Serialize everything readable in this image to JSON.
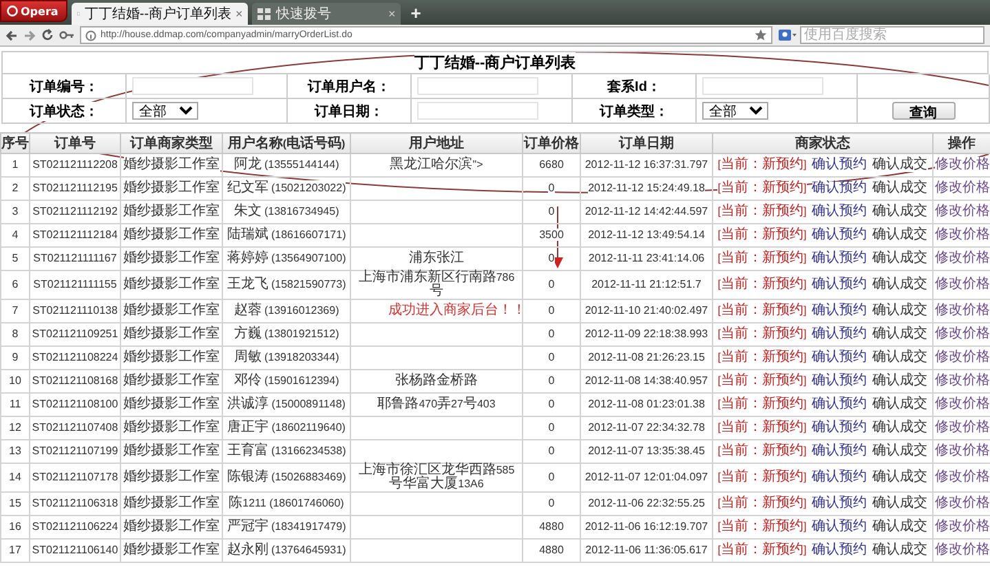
{
  "browser": {
    "menu_button": "Opera",
    "tabs": [
      {
        "title": "丁丁结婚--商户订单列表",
        "selected": true,
        "close": "×"
      },
      {
        "title": "快速拨号",
        "selected": false,
        "close": "×"
      }
    ],
    "new_tab": "+",
    "address": "http://house.ddmap.com/companyadmin/marryOrderList.do",
    "search": {
      "placeholder": "使用百度搜索"
    }
  },
  "page": {
    "title": "丁丁结婚--商户订单列表",
    "filter_rows": [
      [
        {
          "kind": "text",
          "label": "订单编号："
        },
        {
          "kind": "text",
          "label": "订单用户名："
        },
        {
          "kind": "text",
          "label": "套系Id："
        }
      ],
      [
        {
          "kind": "select",
          "label": "订单状态：",
          "value": "全部"
        },
        {
          "kind": "text",
          "label": "订单日期："
        },
        {
          "kind": "select",
          "label": "订单类型：",
          "value": "全部"
        },
        {
          "kind": "button",
          "label": "查询"
        }
      ]
    ],
    "table": {
      "columns": [
        "序号",
        "订单号",
        "订单商家类型",
        "用户名称(电话号码)",
        "用户地址",
        "订单价格",
        "订单日期",
        "商家状态",
        "操作"
      ],
      "rows": [
        {
          "cells": [
            "1",
            "ST021121112208",
            "婚纱摄影工作室",
            "阿龙 (13555144144)",
            "黑龙江哈尔滨\">",
            "6680",
            "2012-11-12 16:37:31.797"
          ],
          "status": "[当前：新预约]",
          "actions": [
            "确认预约",
            "确认成交"
          ],
          "operation": "修改价格"
        },
        {
          "cells": [
            "2",
            "ST021121112195",
            "婚纱摄影工作室",
            "纪文军 (15021203022)",
            "",
            "0",
            "2012-11-12 15:24:49.18"
          ],
          "status": "[当前：新预约]",
          "actions": [
            "确认预约",
            "确认成交"
          ],
          "operation": "修改价格"
        },
        {
          "cells": [
            "3",
            "ST021121112192",
            "婚纱摄影工作室",
            "朱文 (13816734945)",
            "",
            "0",
            "2012-11-12 14:42:44.597"
          ],
          "status": "[当前：新预约]",
          "actions": [
            "确认预约",
            "确认成交"
          ],
          "operation": "修改价格"
        },
        {
          "cells": [
            "4",
            "ST021121112184",
            "婚纱摄影工作室",
            "陆瑞斌 (18616607171)",
            "",
            "3500",
            "2012-11-12 13:49:54.14"
          ],
          "status": "[当前：新预约]",
          "actions": [
            "确认预约",
            "确认成交"
          ],
          "operation": "修改价格"
        },
        {
          "cells": [
            "5",
            "ST021121111167",
            "婚纱摄影工作室",
            "蒋婷婷 (13564907100)",
            "浦东张江",
            "0",
            "2012-11-11 23:41:14.06"
          ],
          "status": "[当前：新预约]",
          "actions": [
            "确认预约",
            "确认成交"
          ],
          "operation": "修改价格"
        },
        {
          "cells": [
            "6",
            "ST021121111155",
            "婚纱摄影工作室",
            "王龙飞 (15821590773)",
            "上海市浦东新区行南路786号",
            "0",
            "2012-11-11 21:12:51.7"
          ],
          "status": "[当前：新预约]",
          "actions": [
            "确认预约",
            "确认成交"
          ],
          "operation": "修改价格"
        },
        {
          "cells": [
            "7",
            "ST021121110138",
            "婚纱摄影工作室",
            "赵蓉 (13916012369)",
            "",
            "0",
            "2012-11-10 21:40:02.497"
          ],
          "status": "[当前：新预约]",
          "actions": [
            "确认预约",
            "确认成交"
          ],
          "operation": "修改价格"
        },
        {
          "cells": [
            "8",
            "ST021121109251",
            "婚纱摄影工作室",
            "方巍 (13801921512)",
            "",
            "0",
            "2012-11-09 22:18:38.993"
          ],
          "status": "[当前：新预约]",
          "actions": [
            "确认预约",
            "确认成交"
          ],
          "operation": "修改价格"
        },
        {
          "cells": [
            "9",
            "ST021121108224",
            "婚纱摄影工作室",
            "周敏 (13918203344)",
            "",
            "0",
            "2012-11-08 21:26:23.15"
          ],
          "status": "[当前：新预约]",
          "actions": [
            "确认预约",
            "确认成交"
          ],
          "operation": "修改价格"
        },
        {
          "cells": [
            "10",
            "ST021121108168",
            "婚纱摄影工作室",
            "邓伶 (15901612394)",
            "张杨路金桥路",
            "0",
            "2012-11-08 14:38:40.957"
          ],
          "status": "[当前：新预约]",
          "actions": [
            "确认预约",
            "确认成交"
          ],
          "operation": "修改价格"
        },
        {
          "cells": [
            "11",
            "ST021121108100",
            "婚纱摄影工作室",
            "洪诚淳 (15000891148)",
            "耶鲁路470弄27号403",
            "0",
            "2012-11-08 01:23:01.38"
          ],
          "status": "[当前：新预约]",
          "actions": [
            "确认预约",
            "确认成交"
          ],
          "operation": "修改价格"
        },
        {
          "cells": [
            "12",
            "ST021121107408",
            "婚纱摄影工作室",
            "唐正宇 (18602119640)",
            "",
            "0",
            "2012-11-07 22:34:32.78"
          ],
          "status": "[当前：新预约]",
          "actions": [
            "确认预约",
            "确认成交"
          ],
          "operation": "修改价格"
        },
        {
          "cells": [
            "13",
            "ST021121107199",
            "婚纱摄影工作室",
            "王育富 (13166234538)",
            "",
            "0",
            "2012-11-07 13:35:38.45"
          ],
          "status": "[当前：新预约]",
          "actions": [
            "确认预约",
            "确认成交"
          ],
          "operation": "修改价格"
        },
        {
          "cells": [
            "14",
            "ST021121107178",
            "婚纱摄影工作室",
            "陈银涛 (15026883469)",
            "上海市徐汇区龙华西路585号华富大厦13A6",
            "0",
            "2012-11-07 12:01:04.097"
          ],
          "status": "[当前：新预约]",
          "actions": [
            "确认预约",
            "确认成交"
          ],
          "operation": "修改价格"
        },
        {
          "cells": [
            "15",
            "ST021121106318",
            "婚纱摄影工作室",
            "陈1211 (18601746060)",
            "",
            "0",
            "2012-11-06 22:32:55.25"
          ],
          "status": "[当前：新预约]",
          "actions": [
            "确认预约",
            "确认成交"
          ],
          "operation": "修改价格"
        },
        {
          "cells": [
            "16",
            "ST021121106224",
            "婚纱摄影工作室",
            "严冠宇 (18341917479)",
            "",
            "4880",
            "2012-11-06 16:12:19.707"
          ],
          "status": "[当前：新预约]",
          "actions": [
            "确认预约",
            "确认成交"
          ],
          "operation": "修改价格"
        },
        {
          "cells": [
            "17",
            "ST021121106140",
            "婚纱摄影工作室",
            "赵永刚 (13764645931)",
            "",
            "4880",
            "2012-11-06 11:36:05.617"
          ],
          "status": "[当前：新预约]",
          "actions": [
            "确认预约",
            "确认成交"
          ],
          "operation": "修改价格"
        }
      ]
    }
  },
  "annotation": {
    "text": "成功进入商家后台！！"
  }
}
